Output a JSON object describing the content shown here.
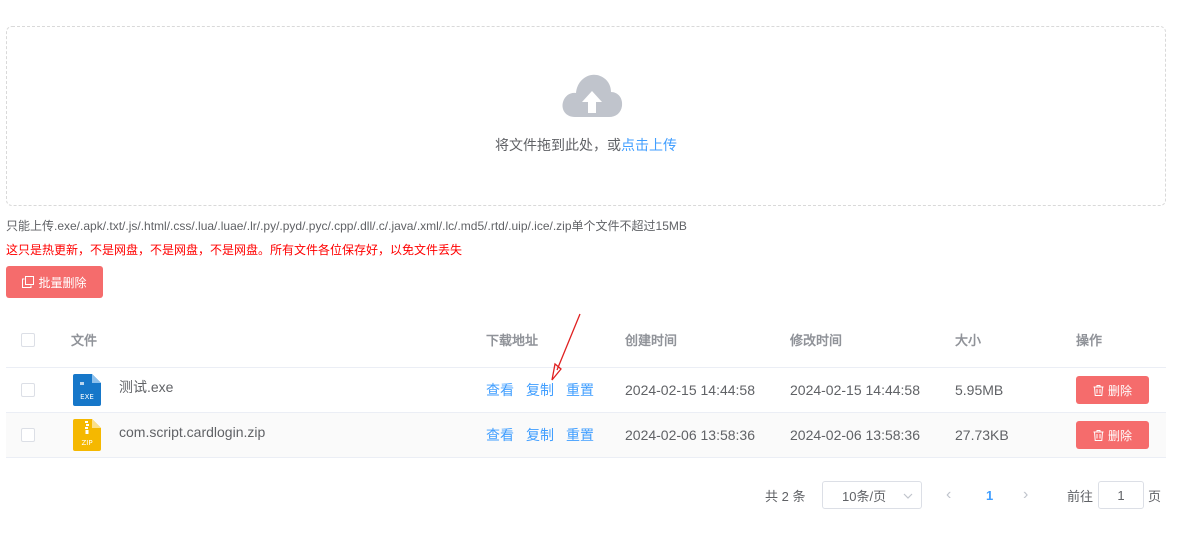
{
  "upload": {
    "hint_prefix": "将文件拖到此处，或",
    "hint_link": "点击上传",
    "icon": "cloud-upload-icon"
  },
  "tip": "只能上传.exe/.apk/.txt/.js/.html/.css/.lua/.luae/.lr/.py/.pyd/.pyc/.cpp/.dll/.c/.java/.xml/.lc/.md5/.rtd/.uip/.ice/.zip单个文件不超过15MB",
  "warning": "这只是热更新，不是网盘，不是网盘，不是网盘。所有文件各位保存好，以免文件丢失",
  "batch_delete_label": "批量删除",
  "table": {
    "headers": {
      "file": "文件",
      "download": "下载地址",
      "created": "创建时间",
      "modified": "修改时间",
      "size": "大小",
      "actions": "操作"
    },
    "rows": [
      {
        "icon": "exe-file-icon",
        "icon_label": "EXE",
        "name": "测试.exe",
        "view": "查看",
        "copy": "复制",
        "reset": "重置",
        "created": "2024-02-15 14:44:58",
        "modified": "2024-02-15 14:44:58",
        "size": "5.95MB",
        "delete": "删除"
      },
      {
        "icon": "zip-file-icon",
        "icon_label": "ZIP",
        "name": "com.script.cardlogin.zip",
        "view": "查看",
        "copy": "复制",
        "reset": "重置",
        "created": "2024-02-06 13:58:36",
        "modified": "2024-02-06 13:58:36",
        "size": "27.73KB",
        "delete": "删除"
      }
    ]
  },
  "pagination": {
    "total": "共 2 条",
    "page_size": "10条/页",
    "prev": "‹",
    "current_page": "1",
    "next": "›",
    "goto_label": "前往",
    "goto_value": "1",
    "goto_unit": "页"
  },
  "colors": {
    "accent": "#409eff",
    "danger": "#f56c6c",
    "warning_text": "#ff0000",
    "exe_icon": "#1677c9",
    "zip_icon": "#f5b800"
  }
}
